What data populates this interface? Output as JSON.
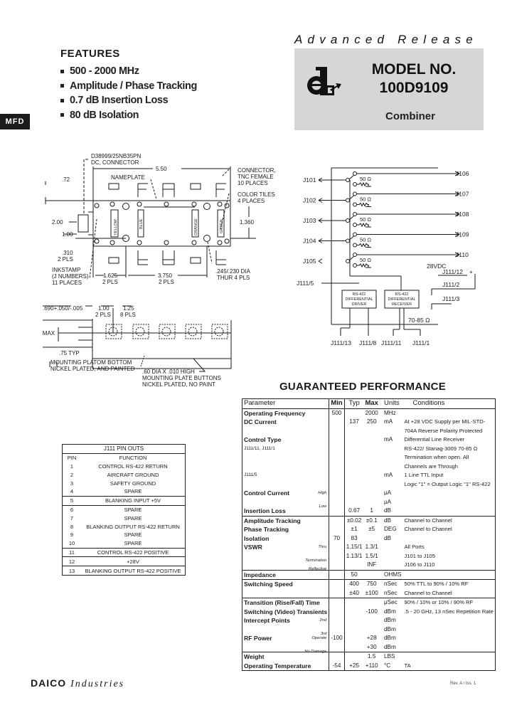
{
  "features": {
    "title": "FEATURES",
    "items": [
      "500 - 2000 MHz",
      "Amplitude / Phase Tracking",
      "0.7 dB Insertion Loss",
      "80 dB Isolation"
    ]
  },
  "section_tab": "MFD",
  "header": {
    "release": "Advanced Release",
    "model_label": "MODEL NO.",
    "model_number": "100D9109",
    "product_type": "Combiner",
    "logo_icon": "daico-logo-icon"
  },
  "outline_drawing": {
    "labels": {
      "connector_dc": "D38999/25NB35PN",
      "connector_dc2": "DC, CONNECTOR",
      "width": "5.50",
      "connector_tnc1": "CONNECTOR,",
      "connector_tnc2": "TNC FEMALE",
      "connector_tnc3": "10 PLACES",
      "nameplate": "NAMEPLATE",
      "dim_72": ".72",
      "color_tiles1": "COLOR TILES",
      "color_tiles2": "4 PLACES",
      "dim_200": "2.00",
      "dim_100": "1.00",
      "dim_1360": "1.360",
      "dim_310": ".310",
      "pls2": "2 PLS",
      "inkstamp1": "INKSTAMP",
      "inkstamp2": "(J NUMBERS)",
      "inkstamp3": "11 PLACES",
      "dim_1625": "1.625",
      "dim_3750": "3.750",
      "hole1": ".245/.230 DIA",
      "hole2": "THUR 4 PLS",
      "tile_yellow": "YELLOW",
      "tile_blue": "BLUE",
      "tile_orange": "ORANGE",
      "tile_green": "GREEN"
    }
  },
  "side_view": {
    "labels": {
      "dim_690": ".690+.050/-.005",
      "dim_1_00": "1.00",
      "dim_1_25": "1.25",
      "pls_2": "2 PLS",
      "pls_8": "8 PLS",
      "max": "1.25 MAX",
      "typ": ".75 TYP",
      "mount1": "MOUNTING PLATOM BOTTOM",
      "mount2": "NICKEL PLATED, AND PAINTED",
      "button1": ".60 DIA X .010 HIGH",
      "button2": "MOUNTING PLATE BUTTONS",
      "button3": "NICKEL PLATED, NO PAINT"
    }
  },
  "schematic": {
    "inputs": [
      "J101",
      "J102",
      "J103",
      "J104",
      "J105"
    ],
    "outputs": [
      "J106",
      "J107",
      "J108",
      "J109",
      "J110"
    ],
    "load": "50 Ω",
    "control_in": "J111/5",
    "power": "28VDC",
    "power_pin": "J111/12",
    "ground_pins": [
      "J111/2",
      "J111/3"
    ],
    "driver": [
      "RS-422",
      "DIFFERENTIAL",
      "DRIVER"
    ],
    "receiver": [
      "RS-422",
      "DIFFERENTIAL",
      "RECEIVER"
    ],
    "termination": "70-85 Ω",
    "bottom_pins": [
      "J111/13",
      "J111/8",
      "J111/11",
      "J111/1"
    ]
  },
  "pinouts": {
    "title": "J111 PIN OUTS",
    "headers": [
      "PIN",
      "FUNCTION"
    ],
    "rows": [
      [
        "1",
        "CONTROL RS-422 RETURN"
      ],
      [
        "2",
        "AIRCRAFT GROUND"
      ],
      [
        "3",
        "SAFETY GROUND"
      ],
      [
        "4",
        "SPARE"
      ],
      [
        "5",
        "BLANKING INPUT +5V"
      ],
      [
        "6",
        "SPARE"
      ],
      [
        "7",
        "SPARE"
      ],
      [
        "8",
        "BLANKING OUTPUT RS-422 RETURN"
      ],
      [
        "9",
        "SPARE"
      ],
      [
        "10",
        "SPARE"
      ],
      [
        "11",
        "CONTROL RS-422 POSITIVE"
      ],
      [
        "12",
        "+28V"
      ],
      [
        "13",
        "BLANKING OUTPUT RS-422 POSITIVE"
      ]
    ]
  },
  "performance": {
    "title": "GUARANTEED PERFORMANCE",
    "headers": [
      "Parameter",
      "Min",
      "Typ",
      "Max",
      "Units",
      "Conditions"
    ],
    "rows": [
      {
        "param": "Operating Frequency",
        "sub": "",
        "min": "500",
        "typ": "",
        "max": "2000",
        "units": "MHz",
        "cond": "",
        "sep": false
      },
      {
        "param": "DC Current",
        "sub": "",
        "min": "",
        "typ": "137",
        "max": "250",
        "units": "mA",
        "cond": "At +28 VDC Supply per MIL-STD-",
        "sep": false
      },
      {
        "param": "",
        "sub": "",
        "min": "",
        "typ": "",
        "max": "",
        "units": "",
        "cond": "704A Reverse Polarity Protected",
        "sep": false
      },
      {
        "param": "Control Type",
        "sub": "",
        "min": "",
        "typ": "",
        "max": "",
        "units": "mA",
        "cond": "Differential Line Receiver",
        "sep": false
      },
      {
        "param": "J111/11, J111/1",
        "small": true,
        "sub": "",
        "min": "",
        "typ": "",
        "max": "",
        "units": "",
        "cond": "RS-422/ Stanag-3009 70-85 Ω",
        "sep": false
      },
      {
        "param": "",
        "sub": "",
        "min": "",
        "typ": "",
        "max": "",
        "units": "",
        "cond": "Termination when open. All",
        "sep": false
      },
      {
        "param": "",
        "sub": "",
        "min": "",
        "typ": "",
        "max": "",
        "units": "",
        "cond": "Channels are Through",
        "sep": false
      },
      {
        "param": "J111/5",
        "small": true,
        "sub": "",
        "min": "",
        "typ": "",
        "max": "",
        "units": "mA",
        "cond": "1 Line TTL Input",
        "sep": false
      },
      {
        "param": "",
        "sub": "",
        "min": "",
        "typ": "",
        "max": "",
        "units": "",
        "cond": "Logic \"1\" = Output Logic \"1\" RS-422",
        "sep": false
      },
      {
        "param": "Control Current",
        "sub": "High",
        "min": "",
        "typ": "",
        "max": "",
        "units": "μA",
        "cond": "",
        "sep": false
      },
      {
        "param": "",
        "sub": "Low",
        "min": "",
        "typ": "",
        "max": "",
        "units": "μA",
        "cond": "",
        "sep": false
      },
      {
        "param": "Insertion Loss",
        "sub": "",
        "min": "",
        "typ": "0.67",
        "max": "1",
        "units": "dB",
        "cond": "",
        "sep": false
      },
      {
        "param": "Amplitude Tracking",
        "sub": "",
        "min": "",
        "typ": "±0.02",
        "max": "±0.1",
        "units": "dB",
        "cond": "Channel to Channel",
        "sep": true
      },
      {
        "param": "Phase Tracking",
        "sub": "",
        "min": "",
        "typ": "±1",
        "max": "±5",
        "units": "DEG",
        "cond": "Channel to Channel",
        "sep": false
      },
      {
        "param": "Isolation",
        "sub": "",
        "min": "70",
        "typ": "83",
        "max": "",
        "units": "dB",
        "cond": "",
        "sep": false
      },
      {
        "param": "VSWR",
        "sub": "Thru",
        "min": "",
        "typ": "1.15/1",
        "max": "1.3/1",
        "units": "",
        "cond": "All Ports",
        "sep": false
      },
      {
        "param": "",
        "sub": "Termination",
        "min": "",
        "typ": "1.13/1",
        "max": "1.5/1",
        "units": "",
        "cond": "J101 to J105",
        "sep": false
      },
      {
        "param": "",
        "sub": "Reflective",
        "min": "",
        "typ": "",
        "max": "INF",
        "units": "",
        "cond": "J106 to J110",
        "sep": false
      },
      {
        "param": "Impedance",
        "sub": "",
        "min": "",
        "typ": "50",
        "max": "",
        "units": "OHMS",
        "cond": "",
        "sep": true
      },
      {
        "param": "Switching Speed",
        "sub": "",
        "min": "",
        "typ": "400",
        "max": "750",
        "units": "nSec",
        "cond": "50% TTL to 90% / 10% RF",
        "sep": true
      },
      {
        "param": "",
        "sub": "",
        "min": "",
        "typ": "±40",
        "max": "±100",
        "units": "nSec",
        "cond": "Channel to Channel",
        "sep": false
      },
      {
        "param": "Transition (Rise/Fall) Time",
        "sub": "",
        "min": "",
        "typ": "",
        "max": "",
        "units": "μSec",
        "cond": "90% / 10% or 10% / 90% RF",
        "sep": true
      },
      {
        "param": "Switching (Video) Transients",
        "sub": "",
        "min": "",
        "typ": "",
        "max": "-100",
        "units": "dBm",
        "cond": ".5 - 20 GHz, 13 nSec Repetition Rate",
        "sep": false
      },
      {
        "param": "Intercept Points",
        "sub": "2nd",
        "min": "",
        "typ": "",
        "max": "",
        "units": "dBm",
        "cond": "",
        "sep": false
      },
      {
        "param": "",
        "sub": "3rd",
        "min": "",
        "typ": "",
        "max": "",
        "units": "dBm",
        "cond": "",
        "sep": false
      },
      {
        "param": "RF Power",
        "sub": "Operate",
        "min": "-100",
        "typ": "",
        "max": "+28",
        "units": "dBm",
        "cond": "",
        "sep": false
      },
      {
        "param": "",
        "sub": "No Damage",
        "min": "",
        "typ": "",
        "max": "+30",
        "units": "dBm",
        "cond": "",
        "sep": false
      },
      {
        "param": "Weight",
        "sub": "",
        "min": "",
        "typ": "",
        "max": "1.5",
        "units": "LBS",
        "cond": "",
        "sep": true
      },
      {
        "param": "Operating Temperature",
        "sub": "",
        "min": "-54",
        "typ": "+25",
        "max": "+110",
        "units": "°C",
        "cond": "TA",
        "sep": false
      }
    ]
  },
  "footer": {
    "brand": "DAICO",
    "brand_suffix": "Industries",
    "revision": "Rev. A / Iss. 1"
  }
}
